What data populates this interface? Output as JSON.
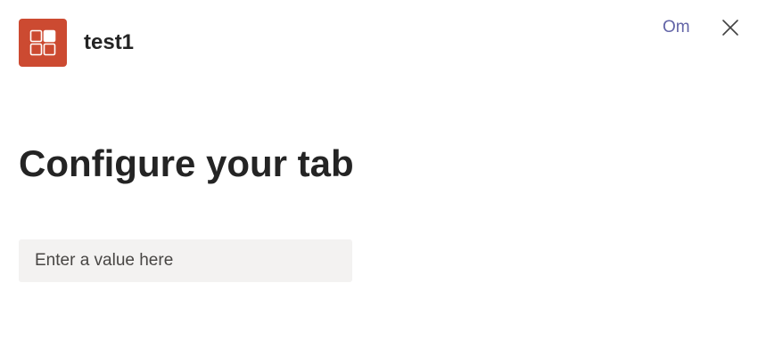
{
  "header": {
    "app_name": "test1",
    "app_icon": "app-grid-icon",
    "about_label": "Om",
    "close_icon": "close-icon"
  },
  "main": {
    "title": "Configure your tab",
    "input": {
      "value": "",
      "placeholder": "Enter a value here"
    }
  },
  "colors": {
    "app_icon_background": "#cc4a31",
    "link": "#6264a7",
    "input_background": "#f3f2f1",
    "text": "#242424"
  }
}
